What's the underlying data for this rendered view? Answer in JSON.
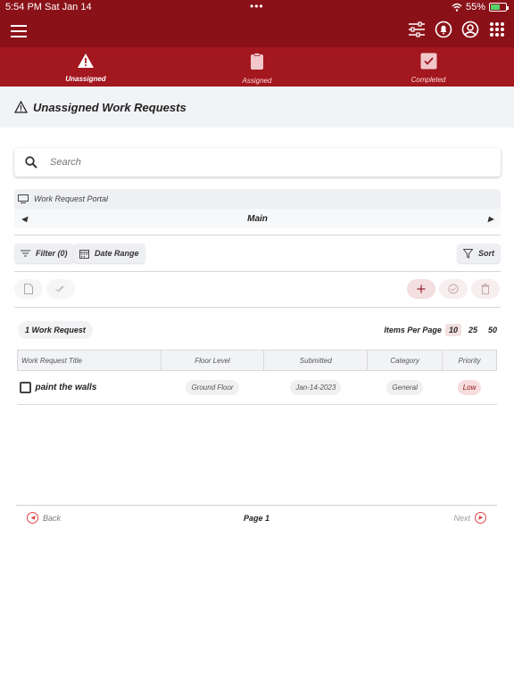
{
  "status_bar": {
    "time": "5:54 PM",
    "date": "Sat Jan 14",
    "battery": "55%"
  },
  "tabs": [
    {
      "label": "Unassigned",
      "icon": "warning-icon",
      "active": true
    },
    {
      "label": "Assigned",
      "icon": "clipboard-icon",
      "active": false
    },
    {
      "label": "Completed",
      "icon": "checkbox-icon",
      "active": false
    }
  ],
  "page": {
    "title": "Unassigned Work Requests"
  },
  "search": {
    "placeholder": "Search"
  },
  "portal": {
    "label": "Work Request Portal",
    "selected": "Main"
  },
  "filters": {
    "filter_label": "Filter (0)",
    "date_range_label": "Date Range",
    "sort_label": "Sort"
  },
  "list": {
    "count_label": "1 Work Request",
    "items_per_page_label": "Items Per Page",
    "items_per_page_options": [
      "10",
      "25",
      "50"
    ],
    "selected_items_per_page": "10"
  },
  "table": {
    "headers": [
      "Work Request Title",
      "Floor Level",
      "Submitted",
      "Category",
      "Priority"
    ],
    "rows": [
      {
        "title": "paint the walls",
        "floor": "Ground Floor",
        "submitted": "Jan-14-2023",
        "category": "General",
        "priority": "Low"
      }
    ]
  },
  "pager": {
    "back": "Back",
    "page": "Page 1",
    "next": "Next"
  },
  "colors": {
    "brand": "#8b1118",
    "tab_bar": "#a3171f",
    "accent_light": "#f6dcdd"
  }
}
